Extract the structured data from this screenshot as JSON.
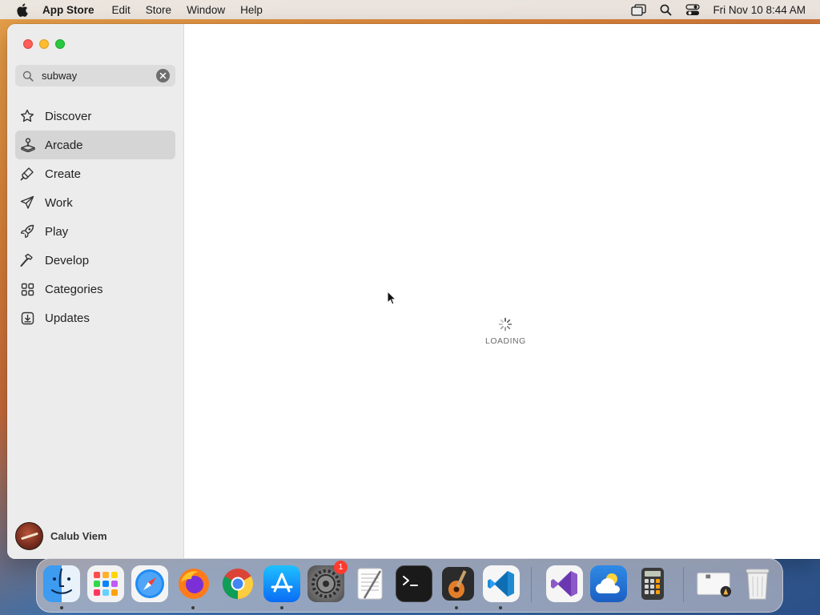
{
  "menubar": {
    "app_name": "App Store",
    "menus": [
      "Edit",
      "Store",
      "Window",
      "Help"
    ],
    "clock": "Fri Nov 10  8:44 AM",
    "status_icons": [
      "screen-mirroring-icon",
      "spotlight-search-icon",
      "control-center-icon"
    ]
  },
  "window": {
    "search": {
      "value": "subway",
      "placeholder": "Search"
    },
    "sidebar": {
      "items": [
        {
          "label": "Discover",
          "icon": "star-icon",
          "active": false
        },
        {
          "label": "Arcade",
          "icon": "joystick-icon",
          "active": true
        },
        {
          "label": "Create",
          "icon": "brush-icon",
          "active": false
        },
        {
          "label": "Work",
          "icon": "paper-plane-icon",
          "active": false
        },
        {
          "label": "Play",
          "icon": "rocket-icon",
          "active": false
        },
        {
          "label": "Develop",
          "icon": "hammer-icon",
          "active": false
        },
        {
          "label": "Categories",
          "icon": "grid-icon",
          "active": false
        },
        {
          "label": "Updates",
          "icon": "download-tray-icon",
          "active": false
        }
      ]
    },
    "user": {
      "name": "Calub Viem"
    },
    "content": {
      "loading_text": "LOADING"
    }
  },
  "dock": {
    "apps": [
      {
        "name": "Finder",
        "icon": "finder-icon",
        "running": true
      },
      {
        "name": "Launchpad",
        "icon": "launchpad-icon",
        "running": false
      },
      {
        "name": "Safari",
        "icon": "safari-icon",
        "running": false
      },
      {
        "name": "Firefox",
        "icon": "firefox-icon",
        "running": true
      },
      {
        "name": "Chrome",
        "icon": "chrome-icon",
        "running": false
      },
      {
        "name": "App Store",
        "icon": "app-store-icon",
        "running": true
      },
      {
        "name": "System Settings",
        "icon": "system-settings-icon",
        "running": false,
        "badge": "1"
      },
      {
        "name": "TextEdit",
        "icon": "textedit-icon",
        "running": false
      },
      {
        "name": "Terminal",
        "icon": "terminal-icon",
        "running": false
      },
      {
        "name": "GarageBand",
        "icon": "garageband-icon",
        "running": true
      },
      {
        "name": "VS Code",
        "icon": "vscode-icon",
        "running": true
      },
      {
        "name": "Visual Studio",
        "icon": "visual-studio-icon",
        "running": false
      },
      {
        "name": "Weather",
        "icon": "weather-icon",
        "running": false
      },
      {
        "name": "Calculator",
        "icon": "calculator-icon",
        "running": false
      },
      {
        "name": "Preview",
        "icon": "preview-icon",
        "running": false
      },
      {
        "name": "Trash",
        "icon": "trash-icon",
        "running": false
      }
    ]
  }
}
